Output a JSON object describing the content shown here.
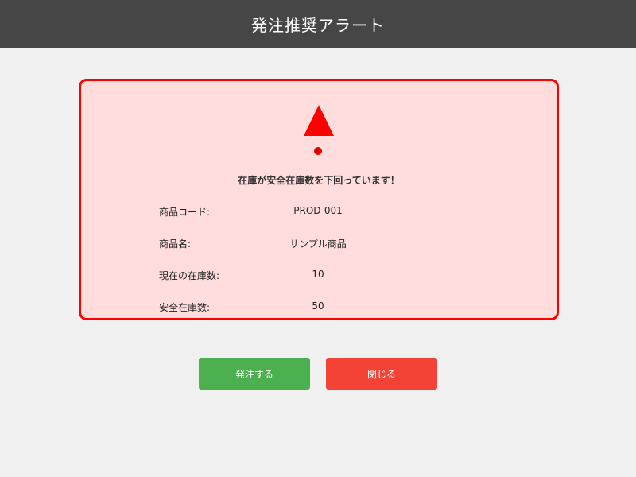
{
  "header": {
    "title": "発注推奨アラート"
  },
  "alert": {
    "message": "在庫が安全在庫数を下回っています！",
    "accent_color": "#ff0000",
    "background_color": "#ffdddd",
    "icon": "warning-icon",
    "rows": [
      {
        "label": "商品コード:",
        "value": "PROD-001"
      },
      {
        "label": "商品名:",
        "value": "サンプル商品"
      },
      {
        "label": "現在の在庫数:",
        "value": "10"
      },
      {
        "label": "安全在庫数:",
        "value": "50"
      }
    ]
  },
  "buttons": {
    "order_label": "発注する",
    "order_color": "#4caf50",
    "close_label": "閉じる",
    "close_color": "#f44336"
  }
}
